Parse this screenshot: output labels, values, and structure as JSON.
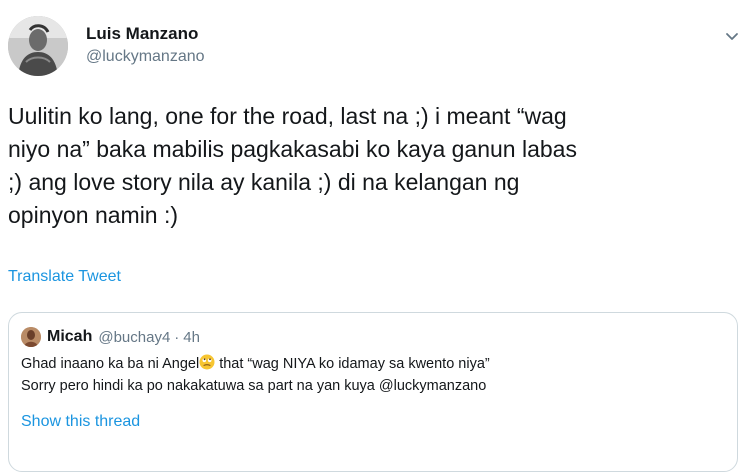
{
  "author": {
    "display_name": "Luis Manzano",
    "handle": "@luckymanzano"
  },
  "tweet": {
    "text": "Uulitin ko lang, one for the road, last na ;) i meant “wag\nniyo na” baka mabilis pagkakasabi ko kaya ganun labas\n;) ang love story nila ay kanila ;) di na kelangan ng\nopinyon namin :)",
    "translate_label": "Translate Tweet"
  },
  "quoted_tweet": {
    "display_name": "Micah",
    "handle": "@buchay4",
    "separator": "·",
    "time": "4h",
    "line1_before_emoji": "Ghad inaano ka ba ni Angel",
    "line1_after_emoji": " that “wag NIYA ko idamay sa kwento niya”",
    "line2": "Sorry pero hindi ka po nakakatuwa sa part na yan kuya @luckymanzano",
    "show_thread_label": "Show this thread"
  },
  "icons": {
    "caret": "chevron-down-icon",
    "emoji": "eye-roll-emoji-icon"
  },
  "colors": {
    "link": "#1b95e0",
    "secondary_text": "#657786",
    "border": "#cfd9de"
  }
}
